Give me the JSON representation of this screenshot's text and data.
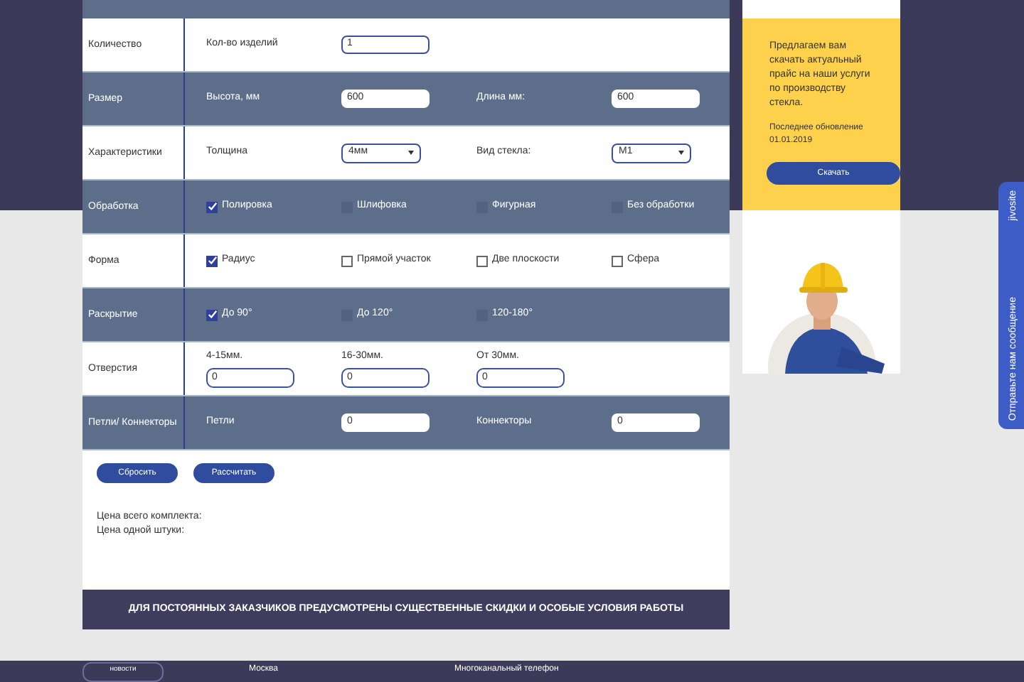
{
  "form": {
    "rows": [
      {
        "label": "Количество",
        "cells": [
          {
            "kind": "text",
            "text": "Кол-во изделий"
          },
          {
            "kind": "input",
            "value": "1"
          }
        ]
      },
      {
        "label": "Размер",
        "cells": [
          {
            "kind": "text",
            "text": "Высота, мм"
          },
          {
            "kind": "input",
            "value": "600"
          },
          {
            "kind": "text",
            "text": "Длина мм:"
          },
          {
            "kind": "input",
            "value": "600"
          }
        ]
      },
      {
        "label": "Характеристики",
        "cells": [
          {
            "kind": "text",
            "text": "Толщина"
          },
          {
            "kind": "select",
            "value": "4мм"
          },
          {
            "kind": "text",
            "text": "Вид стекла:"
          },
          {
            "kind": "select",
            "value": "M1"
          }
        ]
      },
      {
        "label": "Обработка",
        "cells": [
          {
            "kind": "checkbox",
            "label": "Полировка",
            "checked": true
          },
          {
            "kind": "checkbox",
            "label": "Шлифовка",
            "checked": false
          },
          {
            "kind": "checkbox",
            "label": "Фигурная",
            "checked": false
          },
          {
            "kind": "checkbox",
            "label": "Без обработки",
            "checked": false
          }
        ]
      },
      {
        "label": "Форма",
        "cells": [
          {
            "kind": "checkbox",
            "label": "Радиус",
            "checked": true
          },
          {
            "kind": "checkbox",
            "label": "Прямой участок",
            "checked": false
          },
          {
            "kind": "checkbox",
            "label": "Две плоскости",
            "checked": false
          },
          {
            "kind": "checkbox",
            "label": "Сфера",
            "checked": false
          }
        ]
      },
      {
        "label": "Раскрытие",
        "cells": [
          {
            "kind": "checkbox",
            "label": "До 90°",
            "checked": true
          },
          {
            "kind": "checkbox",
            "label": "До 120°",
            "checked": false
          },
          {
            "kind": "checkbox",
            "label": "120-180°",
            "checked": false
          }
        ]
      },
      {
        "label": "Отверстия",
        "cells": [
          {
            "kind": "stacked",
            "label": "4-15мм.",
            "value": "0"
          },
          {
            "kind": "stacked",
            "label": "16-30мм.",
            "value": "0"
          },
          {
            "kind": "stacked",
            "label": "От 30мм.",
            "value": "0"
          }
        ]
      },
      {
        "label": "Петли/ Коннекторы",
        "cells": [
          {
            "kind": "text",
            "text": "Петли"
          },
          {
            "kind": "input",
            "value": "0"
          },
          {
            "kind": "text",
            "text": "Коннекторы"
          },
          {
            "kind": "input",
            "value": "0"
          }
        ]
      }
    ],
    "buttons": [
      "Сбросить",
      "Рассчитать"
    ],
    "results": [
      "Цена всего комплекта:",
      "Цена одной штуки:"
    ],
    "banner": "ДЛЯ ПОСТОЯННЫХ ЗАКАЗЧИКОВ ПРЕДУСМОТРЕНЫ СУЩЕСТВЕННЫЕ СКИДКИ И ОСОБЫЕ УСЛОВИЯ РАБОТЫ"
  },
  "price_card": {
    "text": "Предлагаем вам скачать актуальный прайс на наши услуги по производству стекла.",
    "updated_label": "Последнее обновление",
    "updated_date": "01.01.2019",
    "button": "Скачать"
  },
  "chat_tab": {
    "label": "Отправьте нам сообщение",
    "brand": "jivosite"
  },
  "footer": {
    "button": "новости",
    "city": "Москва",
    "phone_label": "Многоканальный телефон"
  }
}
